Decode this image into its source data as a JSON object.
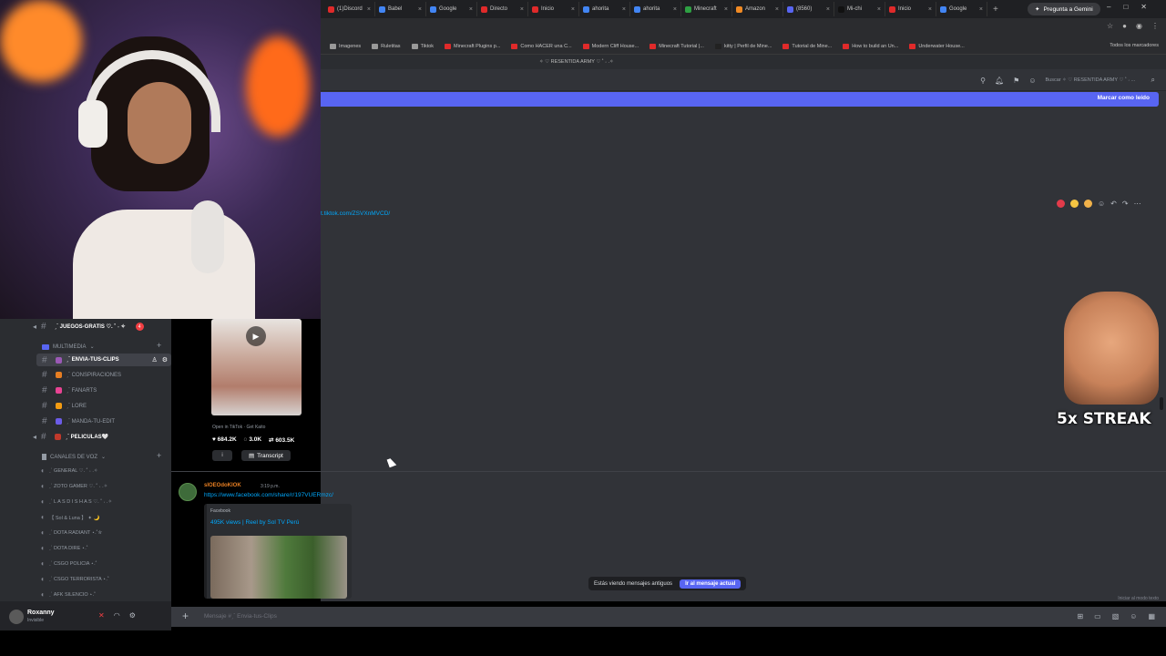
{
  "browser": {
    "tabs": [
      {
        "label": "(1)Discord",
        "color": "#e02a2a"
      },
      {
        "label": "Babel",
        "color": "#4285f4"
      },
      {
        "label": "Google",
        "color": "#4285f4"
      },
      {
        "label": "Directo",
        "color": "#e02a2a"
      },
      {
        "label": "Inicio",
        "color": "#e02a2a"
      },
      {
        "label": "ahorita",
        "color": "#4285f4"
      },
      {
        "label": "ahorita",
        "color": "#4285f4"
      },
      {
        "label": "Minecraft",
        "color": "#2ea043"
      },
      {
        "label": "Amazon",
        "color": "#f08a24"
      },
      {
        "label": "(8560)",
        "color": "#5865f2"
      },
      {
        "label": "Mi-chi",
        "color": "#111111"
      },
      {
        "label": "Inicio",
        "color": "#e02a2a"
      },
      {
        "label": "Google",
        "color": "#4285f4"
      }
    ],
    "new_tab": "+",
    "gemini_button": "Pregunta a Gemini",
    "window_controls": [
      "–",
      "□",
      "✕"
    ],
    "bookmarks": [
      {
        "label": "Imagenes",
        "color": "#999999"
      },
      {
        "label": "Ruletitas",
        "color": "#999999"
      },
      {
        "label": "Tiktok",
        "color": "#999999"
      },
      {
        "label": "Minecraft Plugins p...",
        "color": "#e02a2a"
      },
      {
        "label": "Como HACER una C...",
        "color": "#e02a2a"
      },
      {
        "label": "Modern Cliff House...",
        "color": "#e02a2a"
      },
      {
        "label": "Minecraft Tutorial |...",
        "color": "#e02a2a"
      },
      {
        "label": "kitty | Perfil de Mine...",
        "color": "#222222"
      },
      {
        "label": "Tutorial de Mine...",
        "color": "#e02a2a"
      },
      {
        "label": "How to build an Un...",
        "color": "#e02a2a"
      },
      {
        "label": "Underwater House...",
        "color": "#e02a2a"
      }
    ],
    "all_bookmarks": "Todos los marcadores"
  },
  "discord": {
    "server_title": "✧ ♡ RESENTIDA ARMY ♡ ˚ ˖ .✧",
    "search_placeholder": "Buscar ✧ ♡ RESENTIDA ARMY ♡ ˚ ˖ ...",
    "new_messages_bar": "Marcar como leído",
    "tiktok_link": "t.tiktok.com/ZSVXnMVCD/",
    "streak_text": "5x STREAK",
    "sidebar": {
      "channels_top": [
        {
          "label": "ˏˋ JUEGOS-GRATIS ♡. ˚ ˖ ✧",
          "badge": "4"
        }
      ],
      "category_multimedia": "MULTIMEDIA",
      "channels": [
        {
          "label": "ˏˋ ENVIA-TUS-CLIPS",
          "active": true
        },
        {
          "label": "ˏˋ CONSPIRACIONES",
          "active": false
        },
        {
          "label": "ˏˋ FANARTS",
          "active": false
        },
        {
          "label": "ˏˋ LORE",
          "active": false
        },
        {
          "label": "ˏˋ MANDA-TU-EDIT",
          "active": false
        },
        {
          "label": "ˏˋ PELICULAS🤍",
          "active": false
        }
      ],
      "category_voice": "CANALES DE VOZ",
      "voice_channels": [
        "ˏˋ GENERAL ♡. ˚ ˖ .✧",
        "ˏˋ ZOTO GAMER ♡. ˚ ˖ .✧",
        "ˏˋ L A S D I S H A S ♡. ˚ ˖ .✧",
        "【 Sol & Luna 】 ✦ 🌙",
        "ˏˋ DOTA RADIANT ⋆.˚✮",
        "ˏˋ DOTA DIRE ⋆.˚",
        "ˏˋ CSGO POLICIA ⋆.˚",
        "ˏˋ CSGO TERRORISTA ⋆.˚",
        "ˏˋ AFK SILENCIO ⋆.˚"
      ]
    },
    "clip": {
      "open_label": "Open in TikTok · Get Kaito",
      "likes": "684.2K",
      "comments": "3.0K",
      "shares": "603.5K",
      "info_label": "i",
      "transcript_label": "Transcript"
    },
    "message": {
      "author": "sIOEOdoKIOK",
      "time": "3:19 p.m.",
      "link": "https://www.facebook.com/share/r/197VUERmzc/",
      "embed_provider": "Facebook",
      "embed_title": "495K views | Reel by Sol TV Perú"
    },
    "old_messages_notice": "Estás viendo mensajes antiguos",
    "jump_button": "Ir al mensaje actual",
    "idle_hint": "Iniciar al modo texto",
    "input_placeholder": "Mensaje #ˏˋ Envia-tus-Clips",
    "user": {
      "name": "Roxanny",
      "status": "Invisible"
    }
  }
}
